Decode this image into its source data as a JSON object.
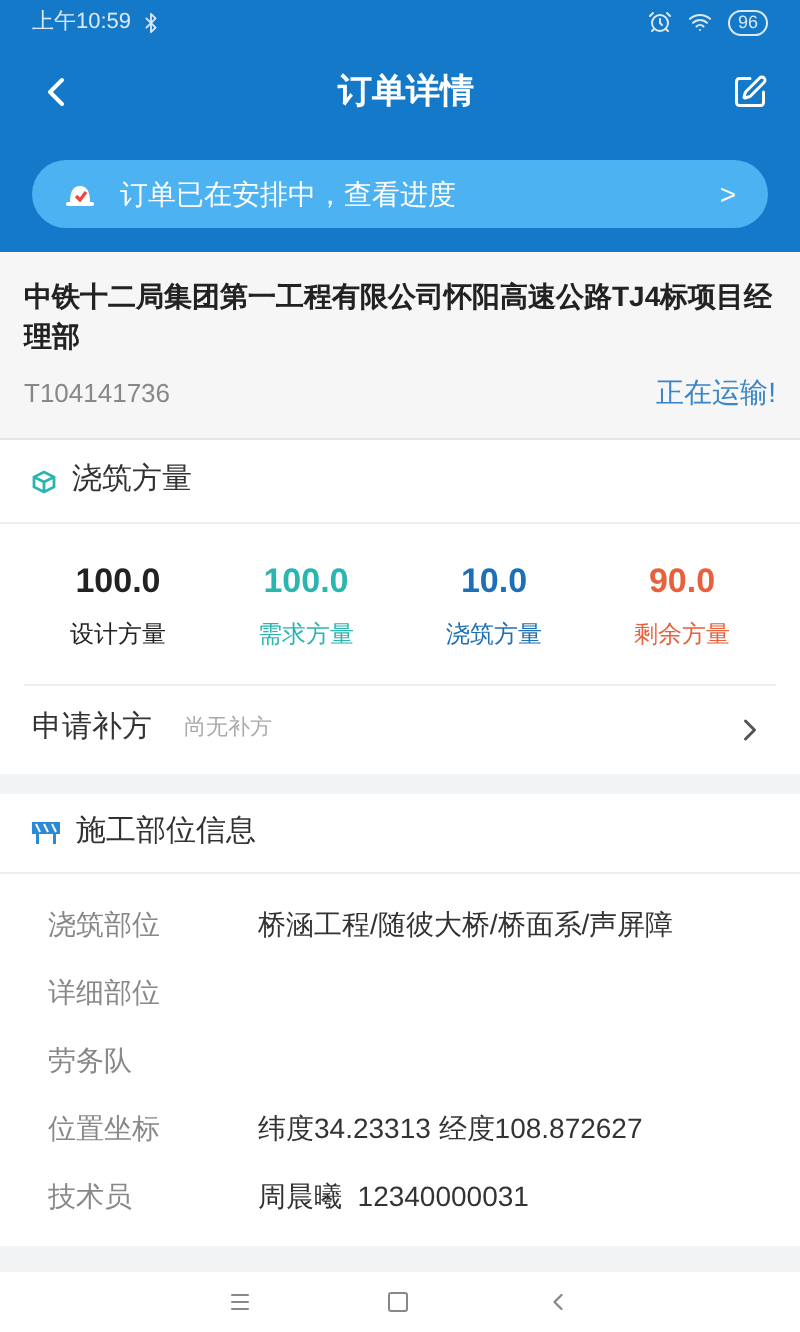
{
  "status_bar": {
    "time": "上午10:59",
    "battery": "96"
  },
  "nav": {
    "title": "订单详情"
  },
  "notice": {
    "text": "订单已在安排中，查看进度",
    "arrow": ">"
  },
  "order": {
    "company": "中铁十二局集团第一工程有限公司怀阳高速公路TJ4标项目经理部",
    "number": "T104141736",
    "status": "正在运输!"
  },
  "volume": {
    "title": "浇筑方量",
    "stats": [
      {
        "value": "100.0",
        "label": "设计方量",
        "color": "#222222"
      },
      {
        "value": "100.0",
        "label": "需求方量",
        "color": "#2bb5b0"
      },
      {
        "value": "10.0",
        "label": "浇筑方量",
        "color": "#1e6fb5"
      },
      {
        "value": "90.0",
        "label": "剩余方量",
        "color": "#e8603c"
      }
    ],
    "supplement": {
      "label": "申请补方",
      "hint": "尚无补方"
    }
  },
  "site": {
    "title": "施工部位信息",
    "rows": [
      {
        "label": "浇筑部位",
        "value": "桥涵工程/随彼大桥/桥面系/声屏障"
      },
      {
        "label": "详细部位"
      },
      {
        "label": "劳务队"
      },
      {
        "label": "位置坐标",
        "value": "纬度34.23313 经度108.872627"
      },
      {
        "label": "技术员",
        "value": "周晨曦  12340000031"
      }
    ]
  }
}
